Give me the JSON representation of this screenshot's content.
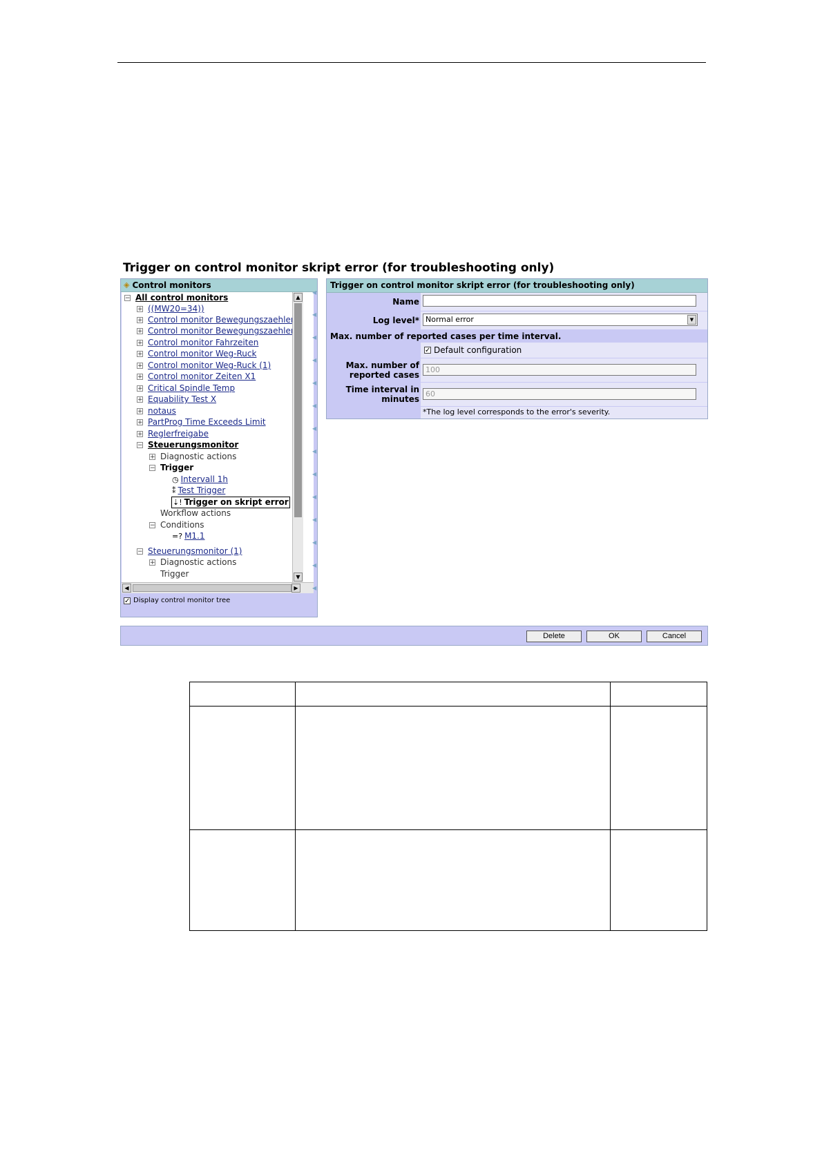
{
  "page_title": "Trigger on control monitor skript error (for troubleshooting only)",
  "tree": {
    "header": "Control monitors",
    "items": [
      {
        "label": "All control monitors"
      },
      {
        "label": "((MW20=34))"
      },
      {
        "label": "Control monitor Bewegungszaehler"
      },
      {
        "label": "Control monitor Bewegungszaehler (:"
      },
      {
        "label": "Control monitor Fahrzeiten"
      },
      {
        "label": "Control monitor Weg-Ruck"
      },
      {
        "label": "Control monitor Weg-Ruck (1)"
      },
      {
        "label": "Control monitor Zeiten X1"
      },
      {
        "label": "Critical Spindle Temp"
      },
      {
        "label": "Equability Test X"
      },
      {
        "label": "notaus"
      },
      {
        "label": "PartProg Time Exceeds Limit"
      },
      {
        "label": "Reglerfreigabe"
      },
      {
        "label": "Steuerungsmonitor"
      },
      {
        "label": "Diagnostic actions"
      },
      {
        "label": "Trigger"
      },
      {
        "label": "Intervall 1h"
      },
      {
        "label": "Test Trigger"
      },
      {
        "label": "Trigger on skript error"
      },
      {
        "label": "Workflow actions"
      },
      {
        "label": "Conditions"
      },
      {
        "label": "M1.1"
      },
      {
        "label": "Steuerungsmonitor (1)"
      },
      {
        "label": "Diagnostic actions"
      },
      {
        "label": "Trigger"
      }
    ],
    "display_tree_label": "Display control monitor tree"
  },
  "form": {
    "header": "Trigger on control monitor skript error (for troubleshooting only)",
    "name_label": "Name",
    "name_value": "",
    "log_level_label": "Log level*",
    "log_level_value": "Normal error",
    "section_label": "Max. number of reported cases per time interval.",
    "default_config_label": "Default configuration",
    "max_cases_label_1": "Max. number of",
    "max_cases_label_2": "reported cases",
    "max_cases_value": "100",
    "interval_label_1": "Time interval in",
    "interval_label_2": "minutes",
    "interval_value": "60",
    "footnote": "*The log level corresponds to the error's severity."
  },
  "buttons": {
    "delete": "Delete",
    "ok": "OK",
    "cancel": "Cancel"
  }
}
